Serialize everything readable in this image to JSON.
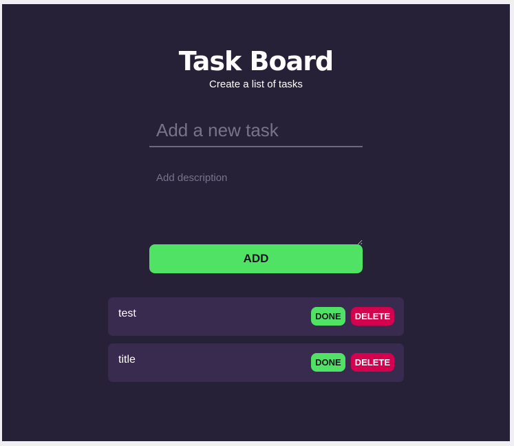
{
  "header": {
    "title": "Task Board",
    "subtitle": "Create a list of tasks"
  },
  "form": {
    "task_placeholder": "Add a new task",
    "task_value": "",
    "description_placeholder": "Add description",
    "description_value": "",
    "add_label": "ADD"
  },
  "tasks": [
    {
      "title": "test",
      "done_label": "DONE",
      "delete_label": "DELETE"
    },
    {
      "title": "title",
      "done_label": "DONE",
      "delete_label": "DELETE"
    }
  ],
  "colors": {
    "background": "#272138",
    "card": "#392a4f",
    "accent_green": "#4fe264",
    "accent_red": "#d2024e"
  }
}
